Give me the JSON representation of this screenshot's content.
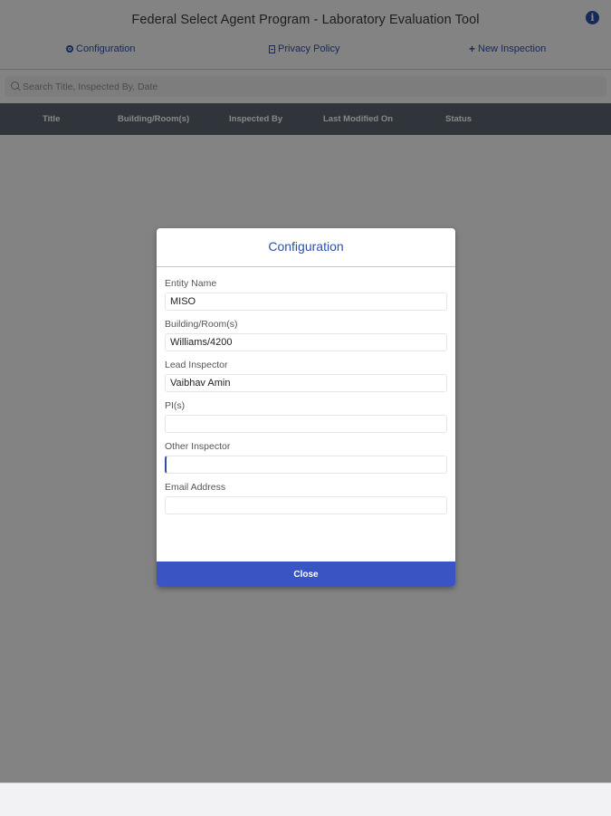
{
  "app": {
    "title": "Federal Select Agent Program - Laboratory Evaluation Tool",
    "nav": {
      "configuration": "Configuration",
      "privacy_policy": "Privacy Policy",
      "new_inspection": "New Inspection"
    },
    "search": {
      "placeholder": "Search Title, Inspected By, Date"
    },
    "table": {
      "columns": [
        "Title",
        "Building/Room(s)",
        "Inspected By",
        "Last Modified On",
        "Status"
      ]
    }
  },
  "modal": {
    "title": "Configuration",
    "fields": [
      {
        "label": "Entity Name",
        "value": "MISO"
      },
      {
        "label": "Building/Room(s)",
        "value": "Williams/4200"
      },
      {
        "label": "Lead Inspector",
        "value": "Vaibhav Amin"
      },
      {
        "label": "PI(s)",
        "value": ""
      },
      {
        "label": "Other Inspector",
        "value": ""
      },
      {
        "label": "Email Address",
        "value": ""
      }
    ],
    "close_label": "Close"
  },
  "colors": {
    "accent": "#2d4fa6",
    "button": "#3955c4",
    "table_header": "#5b6472"
  },
  "icons": [
    "info-icon",
    "gear-icon",
    "document-icon",
    "plus-icon",
    "search-icon"
  ]
}
